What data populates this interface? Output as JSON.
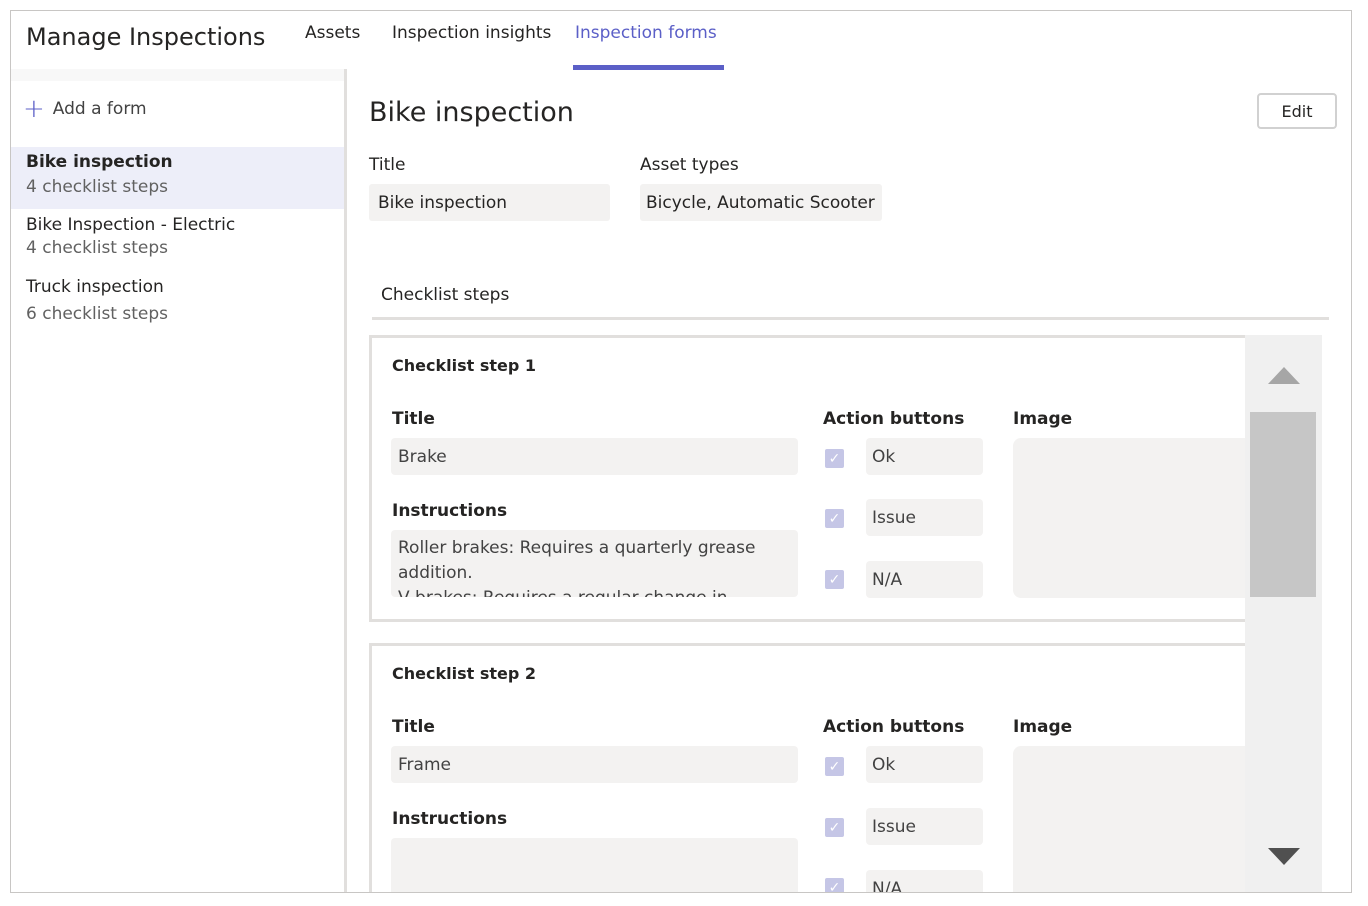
{
  "header": {
    "app_title": "Manage Inspections",
    "tabs": [
      {
        "label": "Assets"
      },
      {
        "label": "Inspection insights"
      },
      {
        "label": "Inspection forms"
      }
    ],
    "active_tab": "Inspection forms"
  },
  "sidebar": {
    "add_form_label": "Add a form",
    "forms": [
      {
        "name": "Bike inspection",
        "steps": "4 checklist steps"
      },
      {
        "name": "Bike Inspection - Electric",
        "steps": "4 checklist steps"
      },
      {
        "name": "Truck inspection",
        "steps": "6 checklist steps"
      }
    ]
  },
  "main": {
    "title": "Bike inspection",
    "edit_label": "Edit",
    "title_label": "Title",
    "title_value": "Bike inspection",
    "asset_types_label": "Asset types",
    "asset_types_value": "Bicycle, Automatic Scooter",
    "checklist_label": "Checklist steps",
    "steps": [
      {
        "heading": "Checklist step 1",
        "title_label": "Title",
        "title_value": "Brake",
        "instructions_label": "Instructions",
        "instructions_value": "Roller brakes: Requires a quarterly grease addition.\nV brakes: Requires a regular change in",
        "action_label": "Action buttons",
        "actions": [
          "Ok",
          "Issue",
          "N/A"
        ],
        "image_label": "Image"
      },
      {
        "heading": "Checklist step 2",
        "title_label": "Title",
        "title_value": "Frame",
        "instructions_label": "Instructions",
        "instructions_value": "",
        "action_label": "Action buttons",
        "actions": [
          "Ok",
          "Issue",
          "N/A"
        ],
        "image_label": "Image"
      }
    ]
  },
  "colors": {
    "accent": "#5b5fc7",
    "selected_bg": "#edeef9",
    "field_bg": "#f3f2f1",
    "checkbox": "#c5c6e6"
  },
  "icons": {
    "add": "plus-icon",
    "check": "checkmark-icon",
    "scroll_up": "triangle-up-icon",
    "scroll_down": "triangle-down-icon"
  }
}
